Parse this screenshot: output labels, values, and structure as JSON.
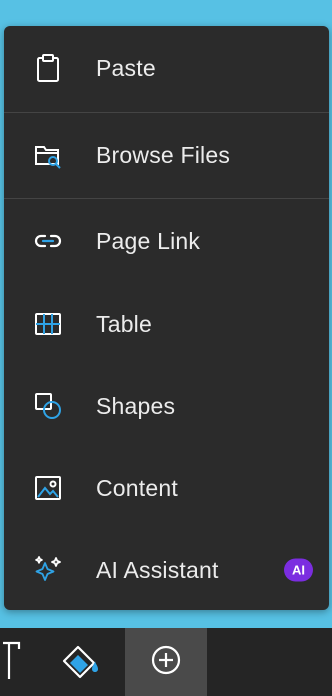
{
  "menu": {
    "items": [
      {
        "label": "Paste",
        "icon": "clipboard-icon"
      },
      {
        "label": "Browse Files",
        "icon": "folder-search-icon"
      },
      {
        "label": "Page Link",
        "icon": "link-icon"
      },
      {
        "label": "Table",
        "icon": "table-icon"
      },
      {
        "label": "Shapes",
        "icon": "shapes-icon"
      },
      {
        "label": "Content",
        "icon": "image-icon"
      },
      {
        "label": "AI Assistant",
        "icon": "sparkles-icon",
        "badge": "AI"
      }
    ]
  },
  "toolbar": {
    "tools": [
      {
        "icon": "text-tool-icon"
      },
      {
        "icon": "paint-bucket-icon"
      },
      {
        "icon": "add-circle-icon",
        "active": true
      }
    ]
  },
  "colors": {
    "accent": "#2fa3e6",
    "badge": "#7b2de0",
    "menu_bg": "#2b2b2b",
    "page_bg": "#57c1e4"
  }
}
